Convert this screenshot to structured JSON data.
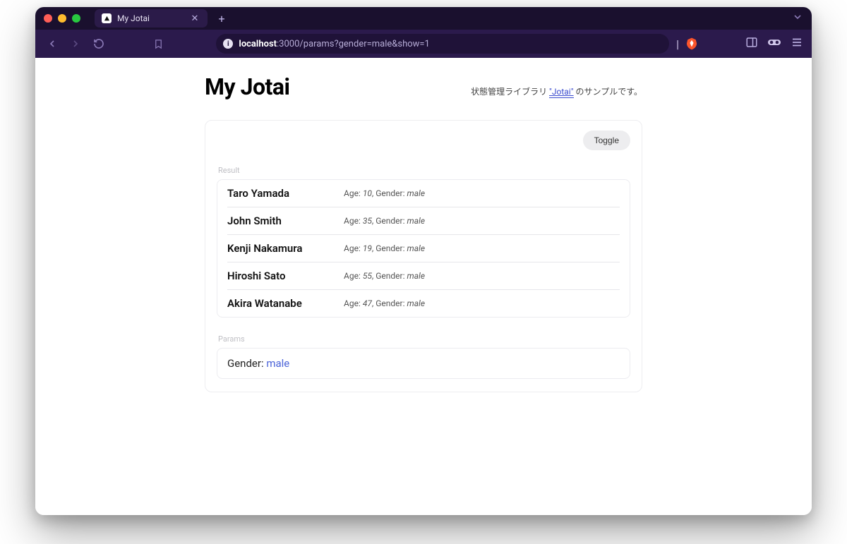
{
  "browser": {
    "tab_title": "My Jotai",
    "url_host": "localhost",
    "url_rest": ":3000/params?gender=male&show=1"
  },
  "header": {
    "title": "My Jotai",
    "subtitle_prefix": "状態管理ライブラリ ",
    "subtitle_link": "\"Jotai\"",
    "subtitle_suffix": " のサンプルです。"
  },
  "actions": {
    "toggle_label": "Toggle"
  },
  "sections": {
    "result_label": "Result",
    "params_label": "Params"
  },
  "meta_labels": {
    "age": "Age: ",
    "gender_sep": ", Gender: "
  },
  "people": [
    {
      "name": "Taro Yamada",
      "age": "10",
      "gender": "male"
    },
    {
      "name": "John Smith",
      "age": "35",
      "gender": "male"
    },
    {
      "name": "Kenji Nakamura",
      "age": "19",
      "gender": "male"
    },
    {
      "name": "Hiroshi Sato",
      "age": "55",
      "gender": "male"
    },
    {
      "name": "Akira Watanabe",
      "age": "47",
      "gender": "male"
    }
  ],
  "params": {
    "label": "Gender: ",
    "value": "male"
  }
}
